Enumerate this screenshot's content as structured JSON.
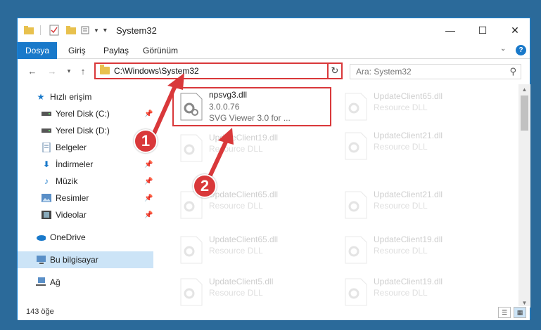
{
  "window": {
    "title": "System32"
  },
  "ribbon": {
    "tabs": [
      {
        "label": "Dosya"
      },
      {
        "label": "Giriş"
      },
      {
        "label": "Paylaş"
      },
      {
        "label": "Görünüm"
      }
    ]
  },
  "address": {
    "path": "C:\\Windows\\System32"
  },
  "search": {
    "placeholder": "Ara: System32"
  },
  "nav": {
    "items": [
      {
        "label": "Hızlı erişim"
      },
      {
        "label": "Yerel Disk (C:)"
      },
      {
        "label": "Yerel Disk (D:)"
      },
      {
        "label": "Belgeler"
      },
      {
        "label": "İndirmeler"
      },
      {
        "label": "Müzik"
      },
      {
        "label": "Resimler"
      },
      {
        "label": "Videolar"
      },
      {
        "label": "OneDrive"
      },
      {
        "label": "Bu bilgisayar"
      },
      {
        "label": "Ağ"
      }
    ]
  },
  "files": {
    "highlighted": {
      "name": "npsvg3.dll",
      "version": "3.0.0.76",
      "description": "SVG Viewer 3.0 for ..."
    },
    "left_column": [
      {
        "name": "UpdateClient19.dll",
        "type": "Resource DLL"
      },
      {
        "name": "UpdateClient65.dll",
        "type": "Resource DLL"
      },
      {
        "name": "UpdateClient65.dll",
        "type": "Resource DLL"
      },
      {
        "name": "UpdateClient5.dll",
        "type": "Resource DLL"
      }
    ],
    "right_column": [
      {
        "name": "UpdateClient65.dll",
        "type": "Resource DLL"
      },
      {
        "name": "UpdateClient21.dll",
        "type": "Resource DLL"
      },
      {
        "name": "UpdateClient21.dll",
        "type": "Resource DLL"
      },
      {
        "name": "UpdateClient19.dll",
        "type": "Resource DLL"
      },
      {
        "name": "UpdateClient19.dll",
        "type": "Resource DLL"
      }
    ]
  },
  "status": {
    "count": "143 öğe"
  },
  "callouts": {
    "one": "1",
    "two": "2"
  },
  "colors": {
    "accent": "#1979ca",
    "highlight": "#d9383a"
  }
}
